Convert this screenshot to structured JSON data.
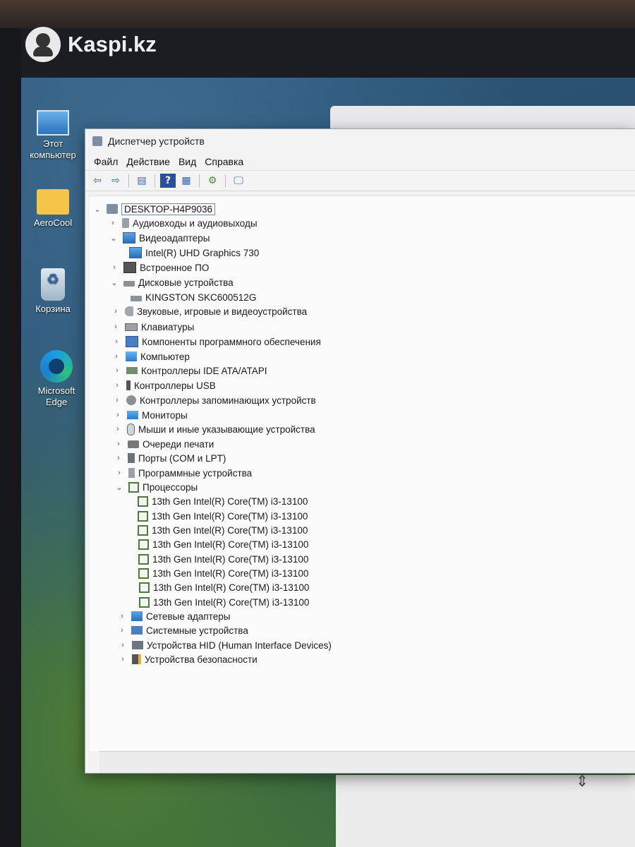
{
  "watermark": "Kaspi.kz",
  "desktop_icons": [
    {
      "label": "Этот компьютер",
      "icon": "computer-icon"
    },
    {
      "label": "AeroCool",
      "icon": "folder-icon"
    },
    {
      "label": "Корзина",
      "icon": "recycle-bin-icon"
    },
    {
      "label": "Microsoft Edge",
      "icon": "edge-icon"
    }
  ],
  "window": {
    "title": "Диспетчер устройств",
    "menu": [
      "Файл",
      "Действие",
      "Вид",
      "Справка"
    ],
    "toolbar": [
      "back-icon",
      "forward-icon",
      "properties-icon",
      "help-icon",
      "view-icon",
      "scan-icon",
      "monitor-icon"
    ]
  },
  "tree": {
    "root": "DESKTOP-H4P9036",
    "categories": [
      {
        "label": "Аудиовходы и аудиовыходы",
        "expanded": false
      },
      {
        "label": "Видеоадаптеры",
        "expanded": true,
        "children": [
          "Intel(R) UHD Graphics 730"
        ]
      },
      {
        "label": "Встроенное ПО",
        "expanded": false
      },
      {
        "label": "Дисковые устройства",
        "expanded": true,
        "children": [
          "KINGSTON SKC600512G"
        ]
      },
      {
        "label": "Звуковые, игровые и видеоустройства",
        "expanded": false
      },
      {
        "label": "Клавиатуры",
        "expanded": false
      },
      {
        "label": "Компоненты программного обеспечения",
        "expanded": false
      },
      {
        "label": "Компьютер",
        "expanded": false
      },
      {
        "label": "Контроллеры IDE ATA/ATAPI",
        "expanded": false
      },
      {
        "label": "Контроллеры USB",
        "expanded": false
      },
      {
        "label": "Контроллеры запоминающих устройств",
        "expanded": false
      },
      {
        "label": "Мониторы",
        "expanded": false
      },
      {
        "label": "Мыши и иные указывающие устройства",
        "expanded": false
      },
      {
        "label": "Очереди печати",
        "expanded": false
      },
      {
        "label": "Порты (COM и LPT)",
        "expanded": false
      },
      {
        "label": "Программные устройства",
        "expanded": false
      },
      {
        "label": "Процессоры",
        "expanded": true,
        "children": [
          "13th Gen Intel(R) Core(TM) i3-13100",
          "13th Gen Intel(R) Core(TM) i3-13100",
          "13th Gen Intel(R) Core(TM) i3-13100",
          "13th Gen Intel(R) Core(TM) i3-13100",
          "13th Gen Intel(R) Core(TM) i3-13100",
          "13th Gen Intel(R) Core(TM) i3-13100",
          "13th Gen Intel(R) Core(TM) i3-13100",
          "13th Gen Intel(R) Core(TM) i3-13100"
        ]
      },
      {
        "label": "Сетевые адаптеры",
        "expanded": false
      },
      {
        "label": "Системные устройства",
        "expanded": false
      },
      {
        "label": "Устройства HID (Human Interface Devices)",
        "expanded": false
      },
      {
        "label": "Устройства безопасности",
        "expanded": false
      }
    ]
  }
}
